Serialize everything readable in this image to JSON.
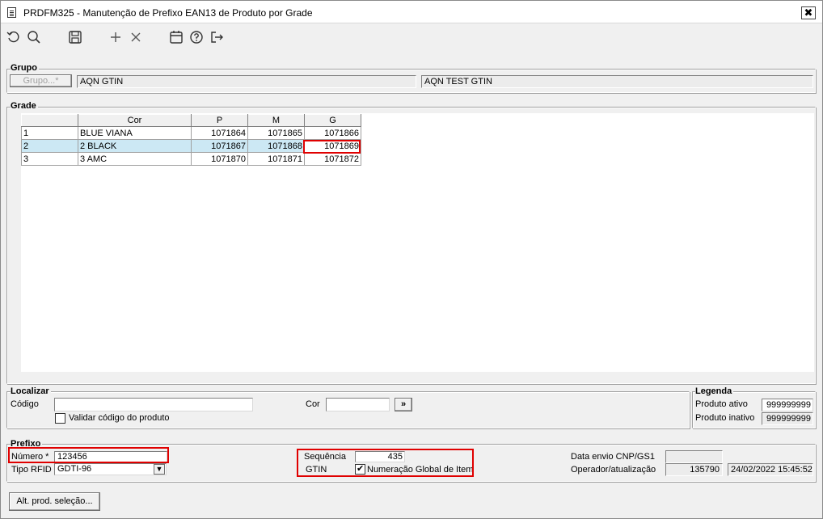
{
  "window": {
    "title": "PRDFM325 - Manutenção de Prefixo EAN13 de Produto por Grade",
    "close_label": "✖"
  },
  "toolbar": {
    "icons": [
      "refresh-icon",
      "search-icon",
      "save-icon",
      "add-icon",
      "delete-icon",
      "calendar-icon",
      "help-icon",
      "exit-icon"
    ]
  },
  "grupo": {
    "title": "Grupo",
    "button_label": "Grupo...*",
    "value": "AQN GTIN",
    "description": "AQN TEST GTIN"
  },
  "grade": {
    "title": "Grade",
    "columns": [
      "",
      "Cor",
      "P",
      "M",
      "G"
    ],
    "rows": [
      [
        "1",
        "BLUE VIANA",
        "1071864",
        "1071865",
        "1071866"
      ],
      [
        "2",
        "2 BLACK",
        "1071867",
        "1071868",
        "1071869"
      ],
      [
        "3",
        "3 AMC",
        "1071870",
        "1071871",
        "1071872"
      ]
    ],
    "selected_row": 1
  },
  "localizar": {
    "title": "Localizar",
    "codigo_label": "Código",
    "codigo_value": "",
    "validar_label": "Validar código do produto",
    "validar_checked": false,
    "cor_label": "Cor",
    "cor_value": "",
    "go_label": "»"
  },
  "legenda": {
    "title": "Legenda",
    "ativo_label": "Produto ativo",
    "ativo_value": "999999999",
    "inativo_label": "Produto inativo",
    "inativo_value": "999999999"
  },
  "prefixo": {
    "title": "Prefixo",
    "numero_label": "Número *",
    "numero_value": "123456",
    "tipo_rfid_label": "Tipo RFID",
    "tipo_rfid_value": "GDTI-96",
    "sequencia_label": "Sequência",
    "sequencia_value": "435",
    "gtin_label": "GTIN",
    "gtin_check_label": "Numeração Global de Item",
    "gtin_checked": true,
    "data_envio_label": "Data envio CNP/GS1",
    "data_envio_value": "",
    "operador_label": "Operador/atualização",
    "operador_value": "135790",
    "atualizacao_value": "24/02/2022 15:45:52"
  },
  "footer": {
    "alt_button_label": "Alt. prod. seleção..."
  },
  "colors": {
    "selection": "#cce8f4",
    "highlight": "#e00000"
  }
}
